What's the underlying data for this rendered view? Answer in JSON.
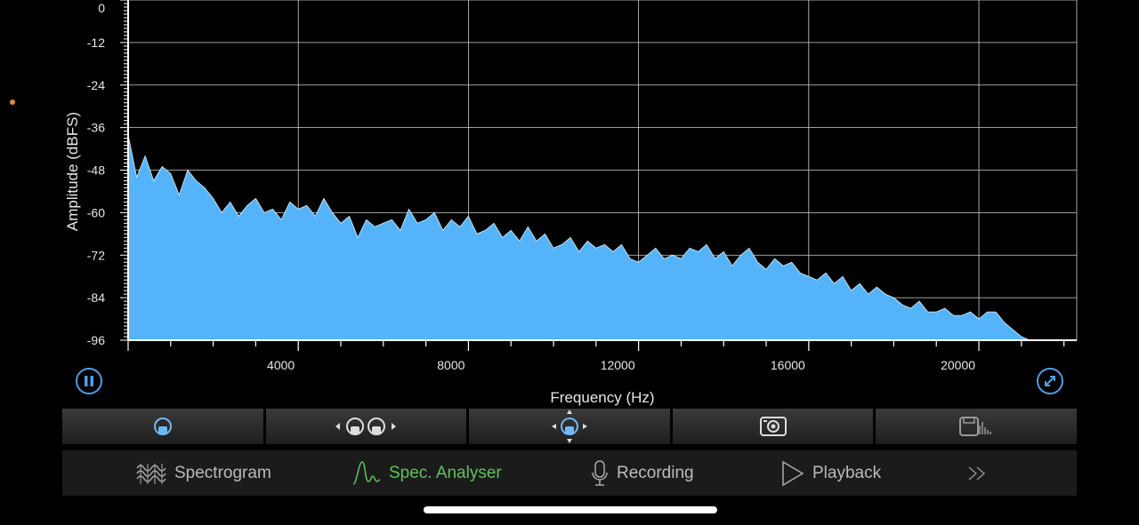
{
  "chart_data": {
    "type": "area",
    "ylabel": "Amplitude (dBFS)",
    "xlabel": "Frequency (Hz)",
    "xlim": [
      0,
      22300
    ],
    "ylim": [
      -96,
      0
    ],
    "xticks": [
      4000,
      8000,
      12000,
      16000,
      20000
    ],
    "yticks": [
      0,
      -12,
      -24,
      -36,
      -48,
      -60,
      -72,
      -84,
      -96
    ],
    "grid": true,
    "fill_color": "#55b4f9",
    "x": [
      0,
      200,
      400,
      600,
      800,
      1000,
      1200,
      1400,
      1600,
      1800,
      2000,
      2200,
      2400,
      2600,
      2800,
      3000,
      3200,
      3400,
      3600,
      3800,
      4000,
      4200,
      4400,
      4600,
      4800,
      5000,
      5200,
      5400,
      5600,
      5800,
      6000,
      6200,
      6400,
      6600,
      6800,
      7000,
      7200,
      7400,
      7600,
      7800,
      8000,
      8200,
      8400,
      8600,
      8800,
      9000,
      9200,
      9400,
      9600,
      9800,
      10000,
      10200,
      10400,
      10600,
      10800,
      11000,
      11200,
      11400,
      11600,
      11800,
      12000,
      12200,
      12400,
      12600,
      12800,
      13000,
      13200,
      13400,
      13600,
      13800,
      14000,
      14200,
      14400,
      14600,
      14800,
      15000,
      15200,
      15400,
      15600,
      15800,
      16000,
      16200,
      16400,
      16600,
      16800,
      17000,
      17200,
      17400,
      17600,
      17800,
      18000,
      18200,
      18400,
      18600,
      18800,
      19000,
      19200,
      19400,
      19600,
      19800,
      20000,
      20200,
      20400,
      20600,
      20800,
      21000,
      21200
    ],
    "values": [
      -38,
      -50,
      -44,
      -51,
      -47,
      -49,
      -55,
      -48,
      -51,
      -53,
      -56,
      -60,
      -57,
      -61,
      -58,
      -56,
      -60,
      -59,
      -62,
      -57,
      -59,
      -58,
      -61,
      -56,
      -60,
      -63,
      -61,
      -67,
      -62,
      -64,
      -63,
      -62,
      -65,
      -59,
      -63,
      -62,
      -60,
      -65,
      -62,
      -64,
      -61,
      -66,
      -65,
      -63,
      -67,
      -65,
      -68,
      -64,
      -68,
      -66,
      -70,
      -69,
      -67,
      -71,
      -68,
      -70,
      -69,
      -71,
      -69,
      -73,
      -74,
      -72,
      -70,
      -73,
      -72,
      -73,
      -70,
      -71,
      -69,
      -73,
      -71,
      -75,
      -72,
      -70,
      -74,
      -76,
      -73,
      -75,
      -74,
      -77,
      -78,
      -79,
      -77,
      -80,
      -78,
      -82,
      -80,
      -83,
      -81,
      -83,
      -84,
      -86,
      -87,
      -85,
      -88,
      -88,
      -87,
      -89,
      -89,
      -88,
      -90,
      -88,
      -88,
      -91,
      -93,
      -95,
      -96
    ]
  },
  "controls": {
    "pause_icon": "pause-icon",
    "fullscreen_icon": "expand-arrows-icon"
  },
  "toolbar": {
    "items": [
      {
        "icon": "single-cursor-lock-icon"
      },
      {
        "icon": "dual-cursor-horizontal-icon"
      },
      {
        "icon": "move-cursor-icon"
      },
      {
        "icon": "camera-icon"
      },
      {
        "icon": "save-data-icon"
      }
    ]
  },
  "tabs": [
    {
      "label": "Spectrogram",
      "icon": "spectrogram-waves-icon",
      "active": false
    },
    {
      "label": "Spec. Analyser",
      "icon": "spectrum-peak-icon",
      "active": true
    },
    {
      "label": "Recording",
      "icon": "microphone-icon",
      "active": false
    },
    {
      "label": "Playback",
      "icon": "play-outline-icon",
      "active": false
    },
    {
      "label": "",
      "icon": "double-chevron-right-icon",
      "active": false
    }
  ],
  "colors": {
    "accent": "#4d9fe8",
    "active_tab": "#5cc35a",
    "grid": "#cfcfcf"
  }
}
